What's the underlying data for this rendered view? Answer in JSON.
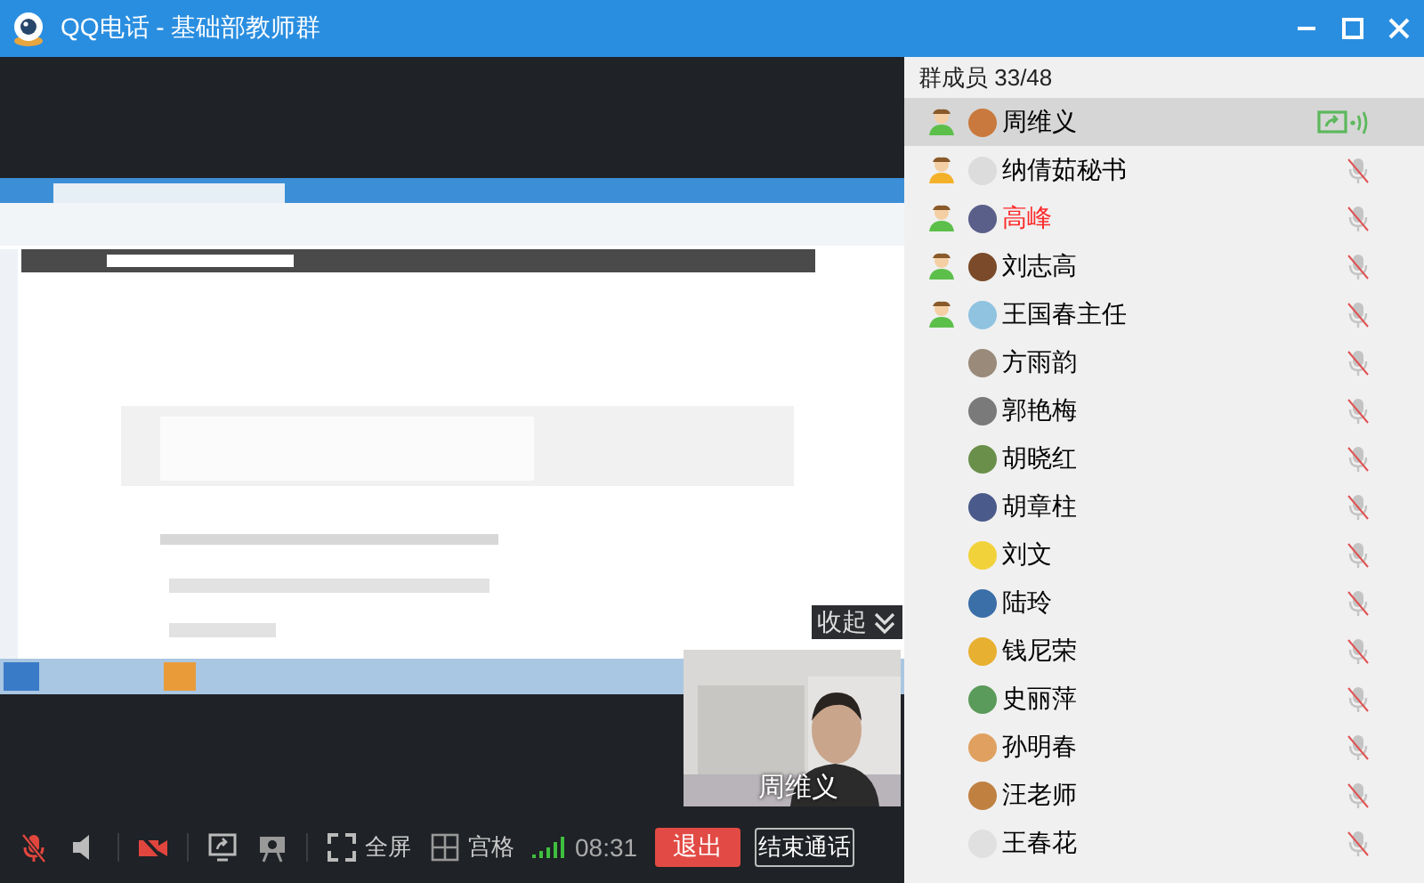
{
  "window": {
    "title": "QQ电话 - 基础部教师群"
  },
  "stage": {
    "collapse_button": "收起",
    "video": {
      "kind": "picture",
      "caption": "周维义"
    }
  },
  "toolbar": [
    {
      "kind": "mic",
      "muted": true
    },
    {
      "kind": "speaker",
      "muted": false
    },
    {
      "kind": "camera",
      "muted": true
    },
    {
      "kind": "share"
    },
    {
      "kind": "projector"
    },
    {
      "kind": "fullscreen",
      "label": "全屏"
    },
    {
      "kind": "grid",
      "label": "宫格"
    }
  ],
  "call": {
    "duration": "08:31",
    "exit_button": "退出",
    "end_button": "结束通话"
  },
  "members": {
    "title": "群成员 33/48",
    "items": [
      {
        "name": "周维义",
        "selected": true,
        "in_call": true,
        "admin": false,
        "color": "#000000",
        "kind": "sharing"
      },
      {
        "name": "纳倩茹秘书",
        "selected": false,
        "in_call": true,
        "admin": true,
        "color": "#000000",
        "kind": "muted"
      },
      {
        "name": "高峰",
        "selected": false,
        "in_call": true,
        "admin": false,
        "color": "#ff2a2a",
        "kind": "muted"
      },
      {
        "name": "刘志高",
        "selected": false,
        "in_call": true,
        "admin": false,
        "color": "#000000",
        "kind": "muted"
      },
      {
        "name": "王国春主任",
        "selected": false,
        "in_call": true,
        "admin": false,
        "color": "#000000",
        "kind": "muted"
      },
      {
        "name": "方雨韵",
        "selected": false,
        "in_call": false,
        "color": "#000000",
        "kind": "muted"
      },
      {
        "name": "郭艳梅",
        "selected": false,
        "in_call": false,
        "color": "#000000",
        "kind": "muted"
      },
      {
        "name": "胡晓红",
        "selected": false,
        "in_call": false,
        "color": "#000000",
        "kind": "muted"
      },
      {
        "name": "胡章柱",
        "selected": false,
        "in_call": false,
        "color": "#000000",
        "kind": "muted"
      },
      {
        "name": "刘文",
        "selected": false,
        "in_call": false,
        "color": "#000000",
        "kind": "muted"
      },
      {
        "name": "陆玲",
        "selected": false,
        "in_call": false,
        "color": "#000000",
        "kind": "muted"
      },
      {
        "name": "钱尼荣",
        "selected": false,
        "in_call": false,
        "color": "#000000",
        "kind": "muted"
      },
      {
        "name": "史丽萍",
        "selected": false,
        "in_call": false,
        "color": "#000000",
        "kind": "muted"
      },
      {
        "name": "孙明春",
        "selected": false,
        "in_call": false,
        "color": "#000000",
        "kind": "muted"
      },
      {
        "name": "汪老师",
        "selected": false,
        "in_call": false,
        "color": "#000000",
        "kind": "muted"
      },
      {
        "name": "王春花",
        "selected": false,
        "in_call": false,
        "color": "#000000",
        "kind": "muted"
      }
    ]
  }
}
